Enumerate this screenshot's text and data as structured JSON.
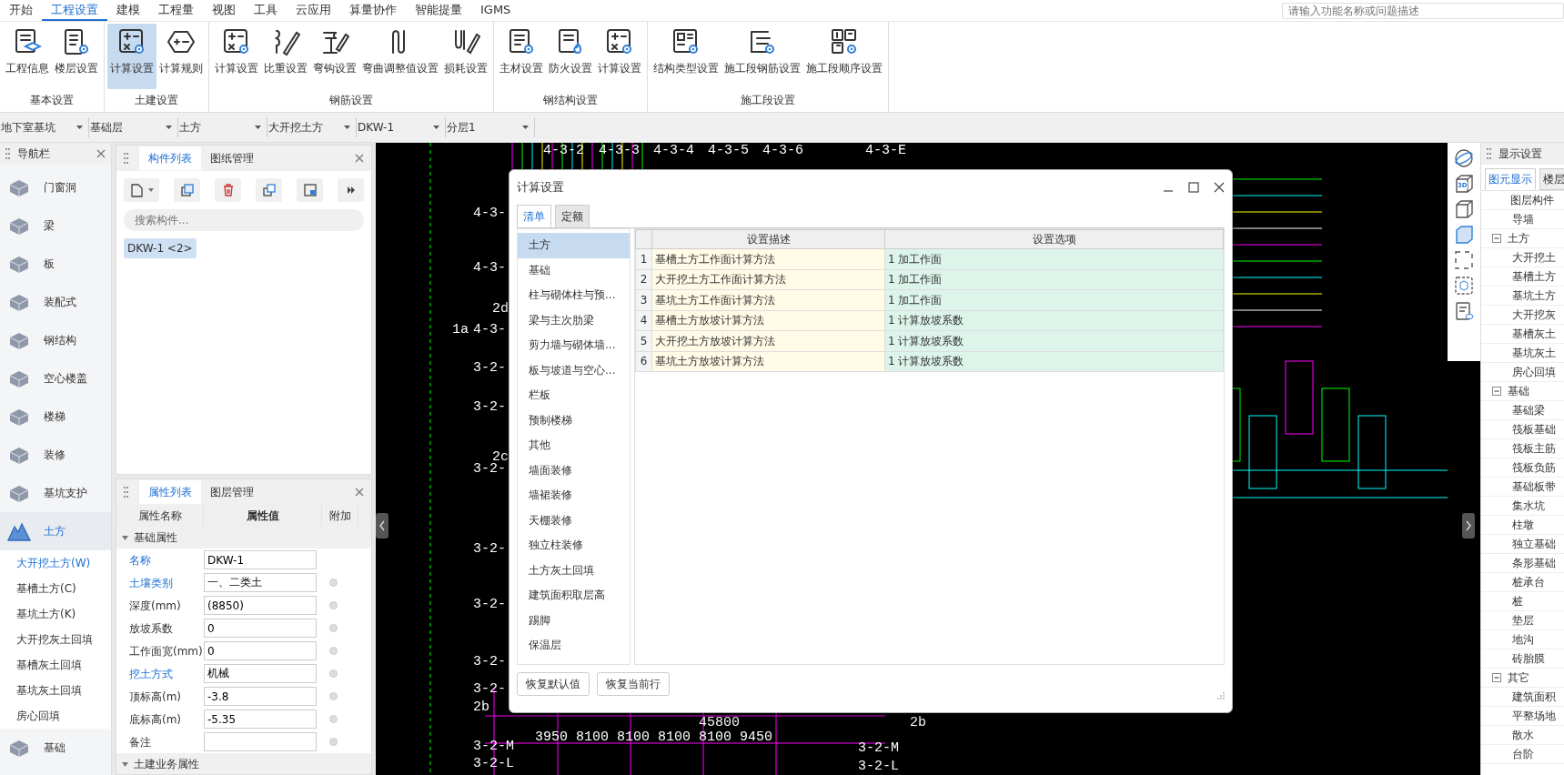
{
  "menu_tabs": [
    {
      "label": "开始",
      "selected": false
    },
    {
      "label": "工程设置",
      "selected": true
    },
    {
      "label": "建模",
      "selected": false
    },
    {
      "label": "工程量",
      "selected": false
    },
    {
      "label": "视图",
      "selected": false
    },
    {
      "label": "工具",
      "selected": false
    },
    {
      "label": "云应用",
      "selected": false
    },
    {
      "label": "算量协作",
      "selected": false
    },
    {
      "label": "智能提量",
      "selected": false
    },
    {
      "label": "IGMS",
      "selected": false
    }
  ],
  "search": {
    "placeholder": "请输入功能名称或问题描述"
  },
  "ribbon_groups": [
    {
      "title": "基本设置",
      "buttons": [
        {
          "label": "工程信息",
          "selected": false
        },
        {
          "label": "楼层设置",
          "selected": false
        }
      ]
    },
    {
      "title": "土建设置",
      "buttons": [
        {
          "label": "计算设置",
          "selected": true
        },
        {
          "label": "计算规则",
          "selected": false
        }
      ]
    },
    {
      "title": "钢筋设置",
      "buttons": [
        {
          "label": "计算设置",
          "selected": false
        },
        {
          "label": "比重设置",
          "selected": false
        },
        {
          "label": "弯钩设置",
          "selected": false
        },
        {
          "label": "弯曲调整值设置",
          "selected": false
        },
        {
          "label": "损耗设置",
          "selected": false
        }
      ]
    },
    {
      "title": "钢结构设置",
      "buttons": [
        {
          "label": "主材设置",
          "selected": false
        },
        {
          "label": "防火设置",
          "selected": false
        },
        {
          "label": "计算设置",
          "selected": false
        }
      ]
    },
    {
      "title": "施工段设置",
      "buttons": [
        {
          "label": "结构类型设置",
          "selected": false
        },
        {
          "label": "施工段钢筋设置",
          "selected": false
        },
        {
          "label": "施工段顺序设置",
          "selected": false
        }
      ]
    }
  ],
  "selectors": [
    "地下室基坑",
    "基础层",
    "土方",
    "大开挖土方",
    "DKW-1",
    "分层1"
  ],
  "nav_panel": {
    "title": "导航栏",
    "items": [
      {
        "label": "门窗洞",
        "selected": false
      },
      {
        "label": "梁",
        "selected": false
      },
      {
        "label": "板",
        "selected": false
      },
      {
        "label": "装配式",
        "selected": false
      },
      {
        "label": "钢结构",
        "selected": false
      },
      {
        "label": "空心楼盖",
        "selected": false
      },
      {
        "label": "楼梯",
        "selected": false
      },
      {
        "label": "装修",
        "selected": false
      },
      {
        "label": "基坑支护",
        "selected": false
      },
      {
        "label": "土方",
        "selected": true,
        "children": [
          {
            "label": "大开挖土方(W)",
            "selected": true
          },
          {
            "label": "基槽土方(C)",
            "selected": false
          },
          {
            "label": "基坑土方(K)",
            "selected": false
          },
          {
            "label": "大开挖灰土回填",
            "selected": false
          },
          {
            "label": "基槽灰土回填",
            "selected": false
          },
          {
            "label": "基坑灰土回填",
            "selected": false
          },
          {
            "label": "房心回填",
            "selected": false
          }
        ]
      },
      {
        "label": "基础",
        "selected": false
      }
    ]
  },
  "component_panel": {
    "tabs": [
      {
        "label": "构件列表",
        "selected": true
      },
      {
        "label": "图纸管理",
        "selected": false
      }
    ],
    "search": {
      "placeholder": "搜索构件..."
    },
    "items": [
      {
        "label": "DKW-1 <2>",
        "selected": true
      }
    ]
  },
  "property_panel": {
    "tabs": [
      {
        "label": "属性列表",
        "selected": true
      },
      {
        "label": "图层管理",
        "selected": false
      }
    ],
    "columns": [
      "属性名称",
      "属性值",
      "附加"
    ],
    "groups": [
      {
        "title": "基础属性",
        "expanded": true,
        "rows": [
          {
            "name": "名称",
            "value": "DKW-1",
            "emphasized": true,
            "attached": false
          },
          {
            "name": "土壤类别",
            "value": "一、二类土",
            "emphasized": true,
            "attached": true
          },
          {
            "name": "深度(mm)",
            "value": "(8850)",
            "emphasized": false,
            "attached": true
          },
          {
            "name": "放坡系数",
            "value": "0",
            "emphasized": false,
            "attached": true
          },
          {
            "name": "工作面宽(mm)",
            "value": "0",
            "emphasized": false,
            "attached": true
          },
          {
            "name": "挖土方式",
            "value": "机械",
            "emphasized": true,
            "attached": true
          },
          {
            "name": "顶标高(m)",
            "value": "-3.8",
            "emphasized": false,
            "attached": true
          },
          {
            "name": "底标高(m)",
            "value": "-5.35",
            "emphasized": false,
            "attached": true
          },
          {
            "name": "备注",
            "emphasized": false,
            "attached": true
          }
        ]
      },
      {
        "title": "土建业务属性",
        "expanded": true
      }
    ]
  },
  "cad": {
    "labels": [
      "4-3-2",
      "4-3-3",
      "4-3-4",
      "4-3-5",
      "4-3-6",
      "4-3-E",
      "4-3-",
      "4-3-",
      "2d",
      "1a",
      "4-3-",
      "3-2-",
      "3-2-",
      "2c",
      "3-2-",
      "3-2-",
      "3-2-",
      "3-2-",
      "3-2-",
      "2b",
      "3-2-M",
      "3-2-L",
      "45800",
      "3950 8100 8100 8100 8100 9450",
      "3-2-M",
      "3-2-L",
      "2b"
    ]
  },
  "view_toolbar": {
    "badge": "3D"
  },
  "dialog": {
    "title": "计算设置",
    "tabs": [
      {
        "label": "清单",
        "selected": true
      },
      {
        "label": "定额",
        "selected": false
      }
    ],
    "categories": [
      {
        "label": "土方",
        "selected": true
      },
      {
        "label": "基础",
        "selected": false
      },
      {
        "label": "柱与砌体柱与预...",
        "selected": false
      },
      {
        "label": "梁与主次肋梁",
        "selected": false
      },
      {
        "label": "剪力墙与砌体墙...",
        "selected": false
      },
      {
        "label": "板与坡道与空心...",
        "selected": false
      },
      {
        "label": "栏板",
        "selected": false
      },
      {
        "label": "预制楼梯",
        "selected": false
      },
      {
        "label": "其他",
        "selected": false
      },
      {
        "label": "墙面装修",
        "selected": false
      },
      {
        "label": "墙裙装修",
        "selected": false
      },
      {
        "label": "天棚装修",
        "selected": false
      },
      {
        "label": "独立柱装修",
        "selected": false
      },
      {
        "label": "土方灰土回填",
        "selected": false
      },
      {
        "label": "建筑面积取层高",
        "selected": false
      },
      {
        "label": "踢脚",
        "selected": false
      },
      {
        "label": "保温层",
        "selected": false
      }
    ],
    "table": {
      "columns": [
        "设置描述",
        "设置选项"
      ],
      "rows": [
        {
          "index": "1",
          "description": "基槽土方工作面计算方法",
          "option": "1 加工作面"
        },
        {
          "index": "2",
          "description": "大开挖土方工作面计算方法",
          "option": "1 加工作面"
        },
        {
          "index": "3",
          "description": "基坑土方工作面计算方法",
          "option": "1 加工作面"
        },
        {
          "index": "4",
          "description": "基槽土方放坡计算方法",
          "option": "1 计算放坡系数"
        },
        {
          "index": "5",
          "description": "大开挖土方放坡计算方法",
          "option": "1 计算放坡系数"
        },
        {
          "index": "6",
          "description": "基坑土方放坡计算方法",
          "option": "1 计算放坡系数"
        }
      ]
    },
    "buttons": [
      "恢复默认值",
      "恢复当前行"
    ]
  },
  "display_panel": {
    "title": "显示设置",
    "tabs": [
      {
        "label": "图元显示",
        "selected": true
      },
      {
        "label": "楼层",
        "selected": false
      }
    ],
    "tree_header": "图层构件",
    "tree": [
      {
        "label": "导墙"
      },
      {
        "label": "土方",
        "expanded": true,
        "children": [
          {
            "label": "大开挖土"
          },
          {
            "label": "基槽土方"
          },
          {
            "label": "基坑土方"
          },
          {
            "label": "大开挖灰"
          },
          {
            "label": "基槽灰土"
          },
          {
            "label": "基坑灰土"
          },
          {
            "label": "房心回填"
          }
        ]
      },
      {
        "label": "基础",
        "expanded": true,
        "children": [
          {
            "label": "基础梁"
          },
          {
            "label": "筏板基础"
          },
          {
            "label": "筏板主筋"
          },
          {
            "label": "筏板负筋"
          },
          {
            "label": "基础板带"
          },
          {
            "label": "集水坑"
          },
          {
            "label": "柱墩"
          },
          {
            "label": "独立基础"
          },
          {
            "label": "条形基础"
          },
          {
            "label": "桩承台"
          },
          {
            "label": "桩"
          },
          {
            "label": "垫层"
          },
          {
            "label": "地沟"
          },
          {
            "label": "砖胎膜"
          }
        ]
      },
      {
        "label": "其它",
        "expanded": true,
        "children": [
          {
            "label": "建筑面积"
          },
          {
            "label": "平整场地"
          },
          {
            "label": "散水"
          },
          {
            "label": "台阶"
          }
        ]
      }
    ]
  }
}
